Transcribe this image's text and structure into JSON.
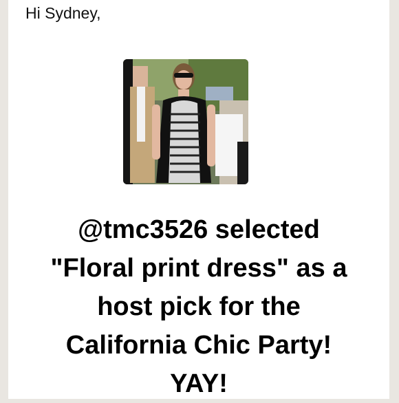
{
  "email": {
    "greeting": "Hi Sydney,",
    "photo_icon": "user-photo",
    "message_lines": [
      "@tmc3526 selected",
      "\"Floral print dress\" as a",
      "host pick for the",
      "California Chic Party!",
      "YAY!"
    ]
  }
}
